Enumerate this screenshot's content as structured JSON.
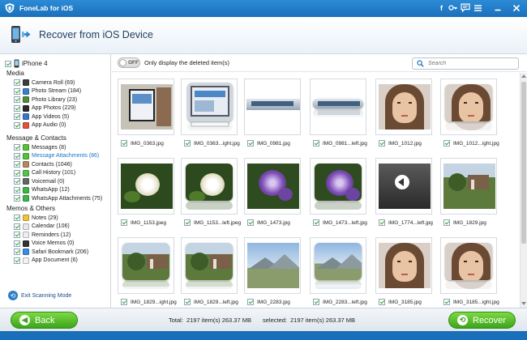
{
  "app": {
    "title": "FoneLab for iOS"
  },
  "header": {
    "title": "Recover from iOS Device"
  },
  "sidebar": {
    "device": "iPhone 4",
    "sections": [
      {
        "title": "Media",
        "items": [
          {
            "label": "Camera Roll (69)",
            "icon": "camera-roll-icon",
            "color": "#3d3d3d"
          },
          {
            "label": "Photo Stream (184)",
            "icon": "photo-stream-icon",
            "color": "#3a80c9"
          },
          {
            "label": "Photo Library (23)",
            "icon": "photo-library-icon",
            "color": "#4f8c3a"
          },
          {
            "label": "App Photos (229)",
            "icon": "app-photos-icon",
            "color": "#2a2a2a"
          },
          {
            "label": "App Videos (5)",
            "icon": "app-videos-icon",
            "color": "#3b75c9"
          },
          {
            "label": "App Audio (0)",
            "icon": "app-audio-icon",
            "color": "#e0533f"
          }
        ]
      },
      {
        "title": "Message & Contacts",
        "items": [
          {
            "label": "Messages (8)",
            "icon": "messages-icon",
            "color": "#55c23a"
          },
          {
            "label": "Message Attachments (86)",
            "icon": "message-attachments-icon",
            "color": "#55c23a",
            "highlighted": true
          },
          {
            "label": "Contacts (1046)",
            "icon": "contacts-icon",
            "color": "#b08a60"
          },
          {
            "label": "Call History (101)",
            "icon": "call-history-icon",
            "color": "#58c24a"
          },
          {
            "label": "Voicemail (0)",
            "icon": "voicemail-icon",
            "color": "#666666"
          },
          {
            "label": "WhatsApp (12)",
            "icon": "whatsapp-icon",
            "color": "#3bb54a"
          },
          {
            "label": "WhatsApp Attachments (75)",
            "icon": "whatsapp-attachments-icon",
            "color": "#3bb54a"
          }
        ]
      },
      {
        "title": "Memos & Others",
        "items": [
          {
            "label": "Notes (29)",
            "icon": "notes-icon",
            "color": "#f0c33c"
          },
          {
            "label": "Calendar (106)",
            "icon": "calendar-icon",
            "color": "#e8e8e8"
          },
          {
            "label": "Reminders (12)",
            "icon": "reminders-icon",
            "color": "#eeeeee"
          },
          {
            "label": "Voice Memos (0)",
            "icon": "voice-memos-icon",
            "color": "#333333"
          },
          {
            "label": "Safari Bookmark (206)",
            "icon": "safari-icon",
            "color": "#3a8de0"
          },
          {
            "label": "App Document (6)",
            "icon": "app-document-icon",
            "color": "#f2f2f2"
          }
        ]
      }
    ],
    "exit_label": "Exit Scanning Mode"
  },
  "toolbar": {
    "toggle_label": "OFF",
    "only_deleted_label": "Only display the deleted item(s)",
    "search_placeholder": "Search"
  },
  "photos": [
    {
      "name": "IMG_0363.jpg",
      "kind": "photo-tablet"
    },
    {
      "name": "IMG_0363...ight.jpg",
      "kind": "reflect-screen"
    },
    {
      "name": "IMG_0981.jpg",
      "kind": "banner-pipe"
    },
    {
      "name": "IMG_0981...left.jpg",
      "kind": "reflect-banner"
    },
    {
      "name": "IMG_1012.jpg",
      "kind": "portrait"
    },
    {
      "name": "IMG_1012...ight.jpg",
      "kind": "reflect-portrait"
    },
    {
      "name": "IMG_1153.jpeg",
      "kind": "flower-white"
    },
    {
      "name": "IMG_1153...left.jpeg",
      "kind": "reflect-flower-white"
    },
    {
      "name": "IMG_1473.jpg",
      "kind": "flower-purple"
    },
    {
      "name": "IMG_1473...left.jpg",
      "kind": "reflect-flower-purple"
    },
    {
      "name": "IMG_1774...left.jpg",
      "kind": "video-thumb"
    },
    {
      "name": "IMG_1829.jpg",
      "kind": "garden"
    },
    {
      "name": "IMG_1829...ight.jpg",
      "kind": "reflect-garden"
    },
    {
      "name": "IMG_1829...left.jpg",
      "kind": "reflect-garden"
    },
    {
      "name": "IMG_2283.jpg",
      "kind": "mountain"
    },
    {
      "name": "IMG_2283...left.jpg",
      "kind": "reflect-mountain"
    },
    {
      "name": "IMG_3185.jpg",
      "kind": "portrait"
    },
    {
      "name": "IMG_3185...ight.jpg",
      "kind": "reflect-portrait"
    }
  ],
  "footer": {
    "back_label": "Back",
    "total_label": "Total:",
    "total_value": "2197 item(s) 263.37 MB",
    "selected_label": "selected:",
    "selected_value": "2197 item(s) 263.37 MB",
    "recover_label": "Recover"
  }
}
